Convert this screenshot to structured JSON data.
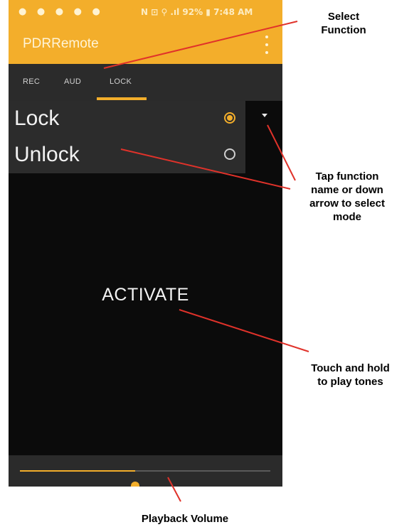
{
  "status_bar": {
    "left_icons": "● ● ● ● ●",
    "right_text": "N ⊡ ⚲ .ıl 92% ▮ 7:48 AM"
  },
  "app": {
    "title": "PDRRemote"
  },
  "tabs": [
    {
      "label": "REC",
      "selected": false
    },
    {
      "label": "AUD",
      "selected": false
    },
    {
      "label": "LOCK",
      "selected": true
    }
  ],
  "mode_options": [
    {
      "label": "Lock",
      "selected": true
    },
    {
      "label": "Unlock",
      "selected": false
    }
  ],
  "activate_label": "ACTIVATE",
  "volume": {
    "level": 0.46
  },
  "annotations": {
    "select_function": "Select\nFunction",
    "tap_function": "Tap function\nname or down\narrow to select\nmode",
    "touch_hold": "Touch and hold\nto play tones",
    "playback_volume": "Playback Volume"
  },
  "colors": {
    "accent": "#f3ae2b",
    "callout": "#e0322a",
    "background": "#0b0b0b",
    "panel": "#2c2c2c"
  }
}
